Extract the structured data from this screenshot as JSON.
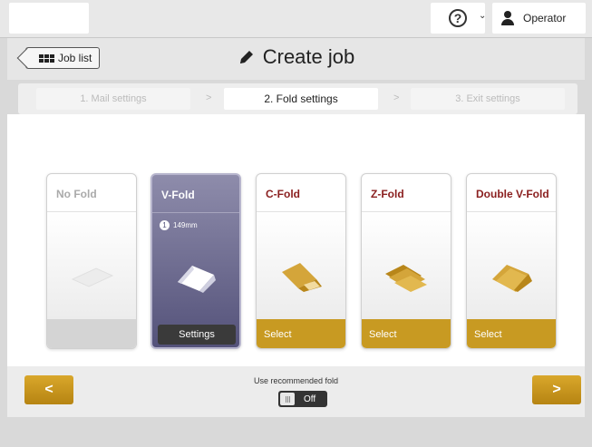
{
  "topbar": {
    "help_icon": "?",
    "user_name": "Operator"
  },
  "header": {
    "back_label": "Job list",
    "title": "Create job"
  },
  "steps": [
    {
      "label": "1. Mail settings",
      "state": "inactive"
    },
    {
      "label": "2. Fold settings",
      "state": "active"
    },
    {
      "label": "3. Exit settings",
      "state": "inactive"
    }
  ],
  "step_separator": ">",
  "folds": [
    {
      "title": "No Fold",
      "action": "",
      "state": "disabled"
    },
    {
      "title": "V-Fold",
      "action": "Settings",
      "state": "selected",
      "badge_num": "1",
      "badge_text": "149mm"
    },
    {
      "title": "C-Fold",
      "action": "Select",
      "state": "available"
    },
    {
      "title": "Z-Fold",
      "action": "Select",
      "state": "available"
    },
    {
      "title": "Double V-Fold",
      "action": "Select",
      "state": "available"
    }
  ],
  "footer": {
    "prev_label": "<",
    "next_label": ">",
    "recommended_label": "Use recommended fold",
    "toggle_text": "Off"
  },
  "colors": {
    "accent_gold": "#c89a22",
    "title_red": "#8b2020",
    "selected_purple": "#54527a"
  }
}
